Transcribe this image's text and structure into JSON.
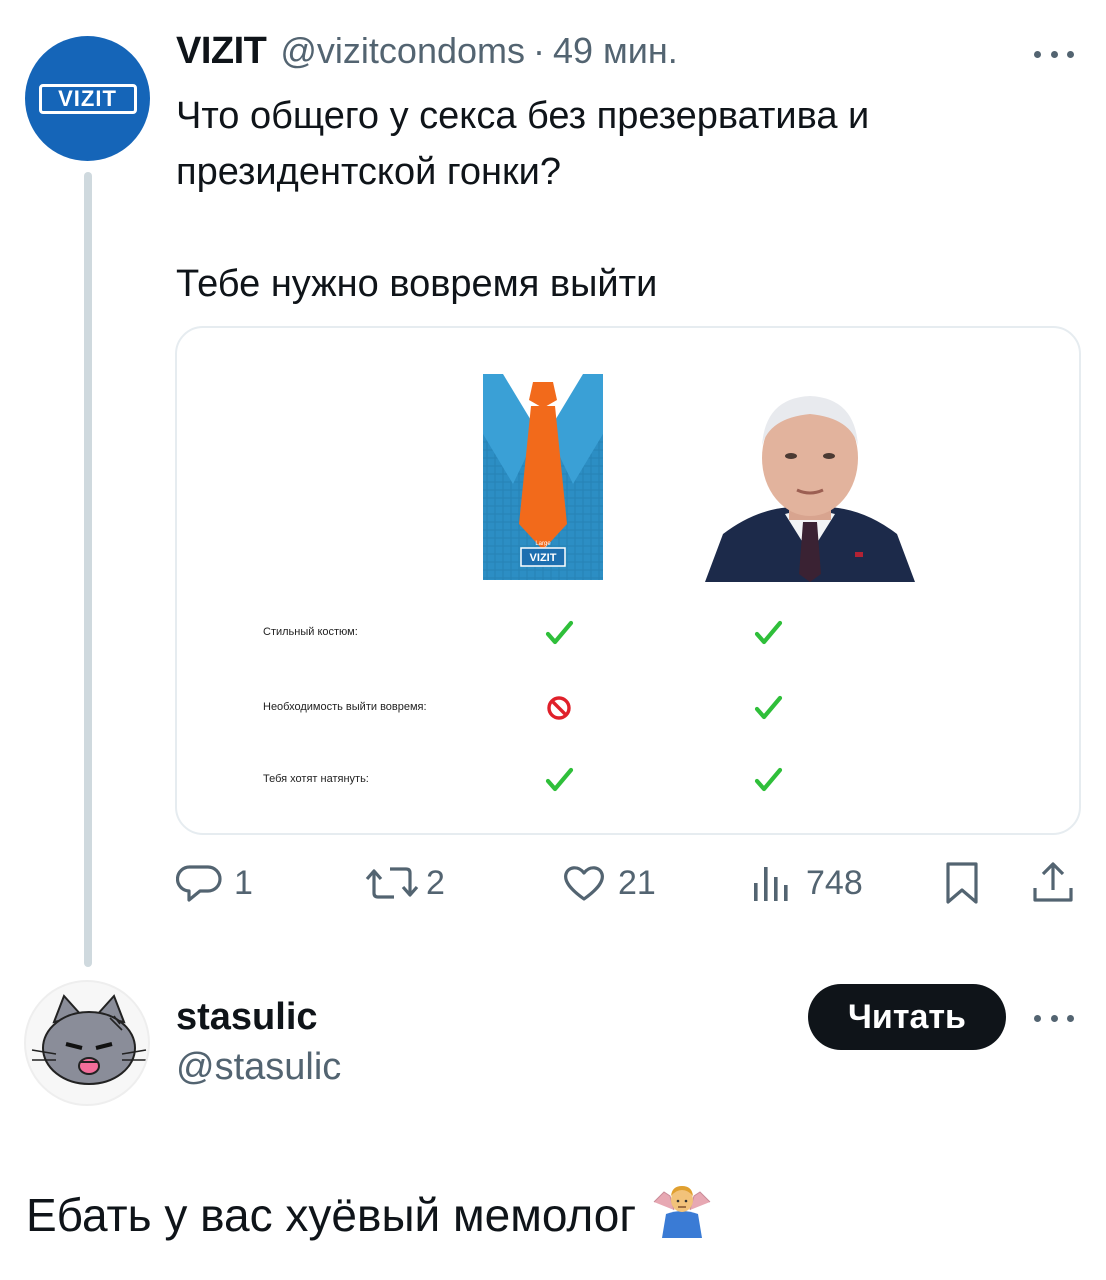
{
  "tweet": {
    "author_name": "VIZIT",
    "author_handle": "@vizitcondoms",
    "separator": "·",
    "time": "49 мин.",
    "avatar_logo_text": "VIZIT",
    "text": "Что общего у секса без презерватива и\nпрезидентской гонки?\n\nТебе нужно вовремя выйти",
    "more_icon": "more-horizontal-icon",
    "media": {
      "pack_label_small": "Large",
      "pack_brand": "VIZIT",
      "rows": [
        {
          "label": "Стильный костюм:",
          "col1": "check",
          "col2": "check"
        },
        {
          "label": "Необходимость выйти вовремя:",
          "col1": "forbidden",
          "col2": "check"
        },
        {
          "label": "Тебя хотят натянуть:",
          "col1": "check",
          "col2": "check"
        }
      ],
      "colors": {
        "check": "#2fbf3a",
        "forbidden": "#e0202a",
        "pack_blue": "#2c8ec4",
        "tie_orange": "#f26a1b"
      }
    },
    "actions": {
      "replies": "1",
      "retweets": "2",
      "likes": "21",
      "views": "748",
      "icons": [
        "reply-icon",
        "retweet-icon",
        "like-icon",
        "views-icon",
        "bookmark-icon",
        "share-icon"
      ]
    }
  },
  "reply": {
    "author_name": "stasulic",
    "author_handle": "@stasulic",
    "follow_label": "Читать",
    "text": "Ебать у вас хуёвый мемолог",
    "emoji": "person-shrugging-emoji"
  },
  "colors": {
    "text_primary": "#0f1419",
    "text_secondary": "#536471",
    "brand_blue": "#1565b8",
    "thread_line": "#cfd9de"
  }
}
